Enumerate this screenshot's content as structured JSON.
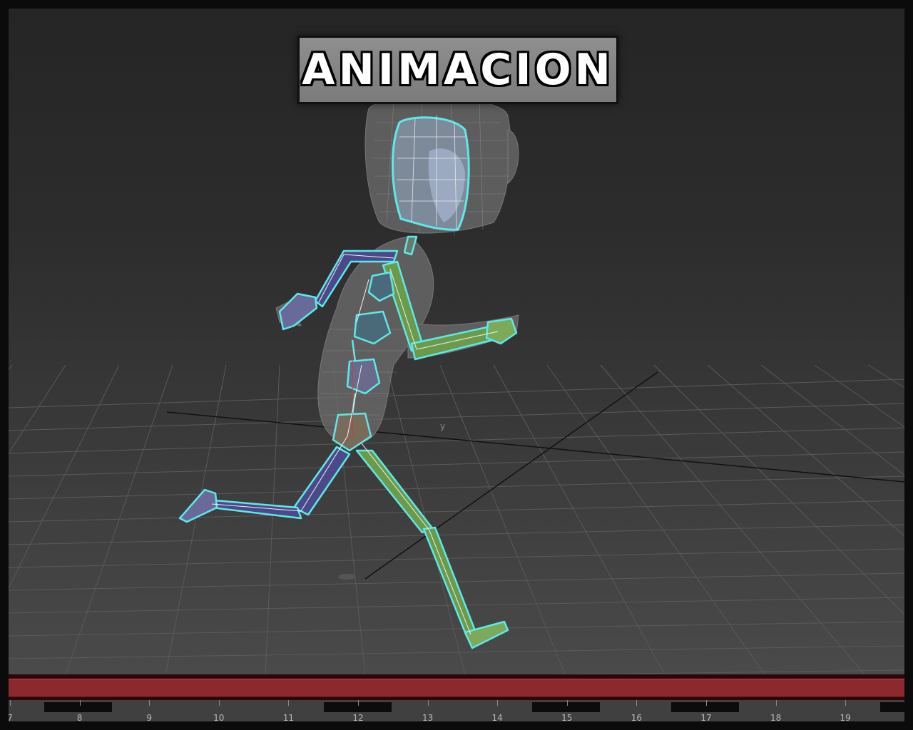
{
  "title": "ANIMACION",
  "timeline": {
    "frame_labels": [
      "7",
      "8",
      "9",
      "10",
      "11",
      "12",
      "13",
      "14",
      "15",
      "16",
      "17",
      "18",
      "19"
    ],
    "range_color": "#8a2a2e"
  },
  "viewport": {
    "axis_label": "y",
    "rig_highlight_color": "#5fe8e8",
    "limb_colors": {
      "left": "#4a4a8a",
      "right": "#6a9a4a"
    }
  },
  "icons": {
    "title": "title-banner",
    "rig": "character-rig-icon"
  }
}
